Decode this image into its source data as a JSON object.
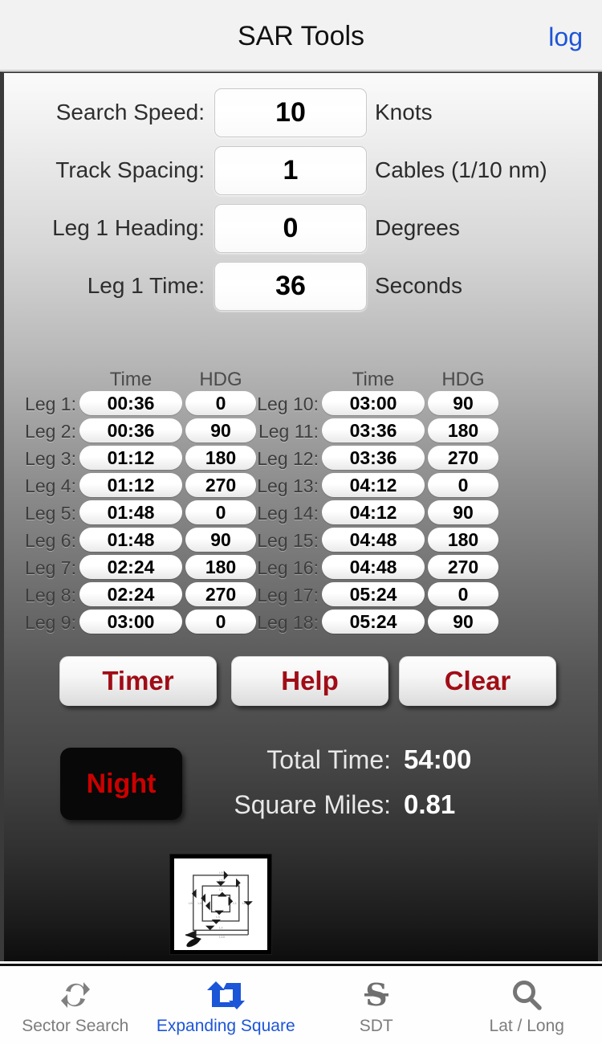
{
  "header": {
    "title": "SAR Tools",
    "log_label": "log"
  },
  "params": [
    {
      "label": "Search Speed:",
      "value": "10",
      "unit": "Knots"
    },
    {
      "label": "Track Spacing:",
      "value": "1",
      "unit": "Cables (1/10 nm)"
    },
    {
      "label": "Leg 1 Heading:",
      "value": "0",
      "unit": "Degrees"
    },
    {
      "label": "Leg 1 Time:",
      "value": "36",
      "unit": "Seconds"
    }
  ],
  "legs": {
    "col_time_header": "Time",
    "col_hdg_header": "HDG",
    "left": [
      {
        "label": "Leg 1:",
        "time": "00:36",
        "hdg": "0"
      },
      {
        "label": "Leg 2:",
        "time": "00:36",
        "hdg": "90"
      },
      {
        "label": "Leg 3:",
        "time": "01:12",
        "hdg": "180"
      },
      {
        "label": "Leg 4:",
        "time": "01:12",
        "hdg": "270"
      },
      {
        "label": "Leg 5:",
        "time": "01:48",
        "hdg": "0"
      },
      {
        "label": "Leg 6:",
        "time": "01:48",
        "hdg": "90"
      },
      {
        "label": "Leg 7:",
        "time": "02:24",
        "hdg": "180"
      },
      {
        "label": "Leg 8:",
        "time": "02:24",
        "hdg": "270"
      },
      {
        "label": "Leg 9:",
        "time": "03:00",
        "hdg": "0"
      }
    ],
    "right": [
      {
        "label": "Leg 10:",
        "time": "03:00",
        "hdg": "90"
      },
      {
        "label": "Leg 11:",
        "time": "03:36",
        "hdg": "180"
      },
      {
        "label": "Leg 12:",
        "time": "03:36",
        "hdg": "270"
      },
      {
        "label": "Leg 13:",
        "time": "04:12",
        "hdg": "0"
      },
      {
        "label": "Leg 14:",
        "time": "04:12",
        "hdg": "90"
      },
      {
        "label": "Leg 15:",
        "time": "04:48",
        "hdg": "180"
      },
      {
        "label": "Leg 16:",
        "time": "04:48",
        "hdg": "270"
      },
      {
        "label": "Leg 17:",
        "time": "05:24",
        "hdg": "0"
      },
      {
        "label": "Leg 18:",
        "time": "05:24",
        "hdg": "90"
      }
    ]
  },
  "actions": {
    "timer_label": "Timer",
    "help_label": "Help",
    "clear_label": "Clear"
  },
  "night": {
    "label": "Night"
  },
  "totals": {
    "total_time_label": "Total Time:",
    "total_time_value": "54:00",
    "square_miles_label": "Square Miles:",
    "square_miles_value": "0.81"
  },
  "pattern_thumbnail": {
    "icon": "expanding-square-diagram"
  },
  "tabs": [
    {
      "label": "Sector Search",
      "icon": "refresh-circular-arrows-icon",
      "active": false
    },
    {
      "label": "Expanding Square",
      "icon": "expanding-square-arrows-icon",
      "active": true
    },
    {
      "label": "SDT",
      "icon": "s-divide-icon",
      "active": false
    },
    {
      "label": "Lat / Long",
      "icon": "magnifier-icon",
      "active": false
    }
  ],
  "colors": {
    "accent_blue": "#1d55d8",
    "action_red": "#a00d16",
    "night_red": "#cc0000",
    "tab_gray": "#7d7d7d"
  }
}
